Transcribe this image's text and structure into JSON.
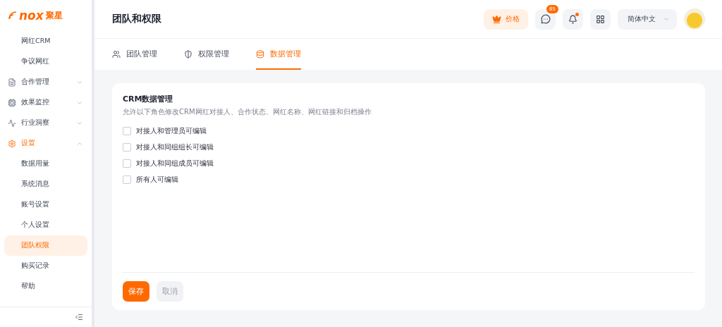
{
  "logo": {
    "text": "nox",
    "suffix": "聚星"
  },
  "sidebar": {
    "items": [
      {
        "label": "网红CRM",
        "kind": "sub",
        "selected": false
      },
      {
        "label": "争议网红",
        "kind": "sub",
        "selected": false
      },
      {
        "label": "合作管理",
        "kind": "group",
        "expanded": false
      },
      {
        "label": "效果监控",
        "kind": "group",
        "expanded": false
      },
      {
        "label": "行业洞察",
        "kind": "group",
        "expanded": false
      },
      {
        "label": "设置",
        "kind": "group",
        "expanded": true
      },
      {
        "label": "数据用量",
        "kind": "sub",
        "selected": false
      },
      {
        "label": "系统消息",
        "kind": "sub",
        "selected": false
      },
      {
        "label": "账号设置",
        "kind": "sub",
        "selected": false
      },
      {
        "label": "个人设置",
        "kind": "sub",
        "selected": false
      },
      {
        "label": "团队权限",
        "kind": "sub",
        "selected": true
      },
      {
        "label": "购买记录",
        "kind": "sub",
        "selected": false
      },
      {
        "label": "帮助",
        "kind": "sub",
        "selected": false
      }
    ]
  },
  "header": {
    "title": "团队和权限",
    "price_button": "价格",
    "messages_badge": "65",
    "notification_dot": true,
    "language": "简体中文"
  },
  "tabs": [
    {
      "label": "团队管理",
      "selected": false
    },
    {
      "label": "权限管理",
      "selected": false
    },
    {
      "label": "数据管理",
      "selected": true
    }
  ],
  "card": {
    "title": "CRM数据管理",
    "description": "允许以下角色修改CRM网红对接人、合作状态、网红名称、网红链接和归档操作",
    "options": [
      {
        "label": "对接人和管理员可编辑",
        "checked": false
      },
      {
        "label": "对接人和同组组长可编辑",
        "checked": false
      },
      {
        "label": "对接人和同组成员可编辑",
        "checked": false
      },
      {
        "label": "所有人可编辑",
        "checked": false
      }
    ],
    "save": "保存",
    "cancel": "取消"
  }
}
